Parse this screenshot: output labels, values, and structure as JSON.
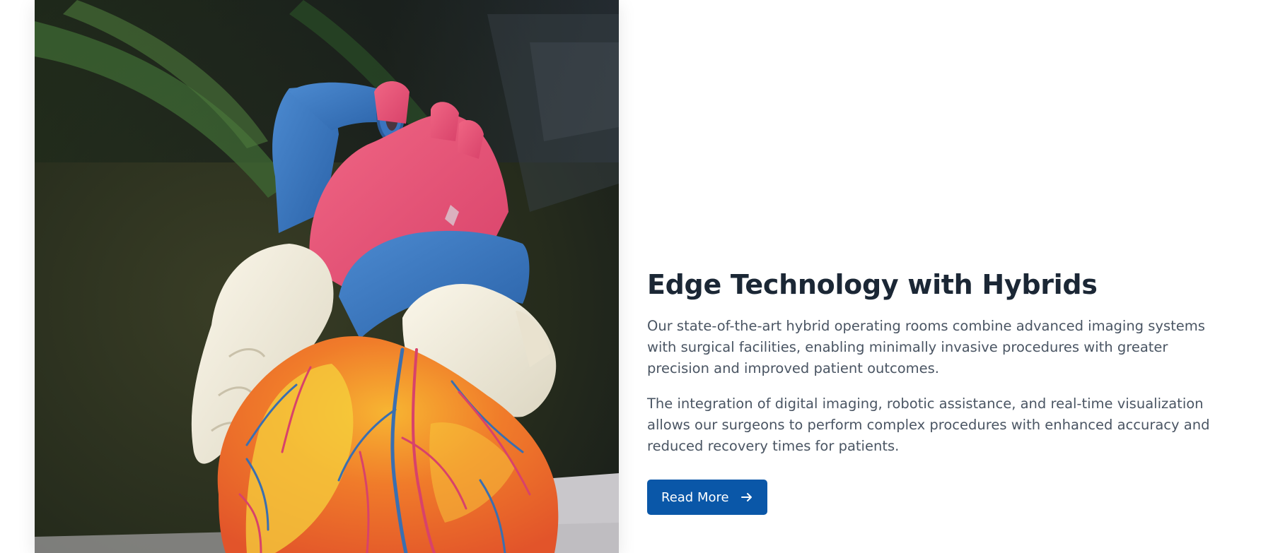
{
  "feature": {
    "image_alt": "Anatomical heart model",
    "heading": "Edge Technology with Hybrids",
    "paragraphs": [
      "Our state-of-the-art hybrid operating rooms combine advanced imaging systems with surgical facilities, enabling minimally invasive procedures with greater precision and improved patient outcomes.",
      "The integration of digital imaging, robotic assistance, and real-time visualization allows our surgeons to perform complex procedures with enhanced accuracy and reduced recovery times for patients."
    ],
    "cta_label": "Read More",
    "cta_icon": "arrow-right-icon"
  },
  "colors": {
    "heading": "#1b2735",
    "body_text": "#4a5563",
    "button_bg": "#0a57a8",
    "button_text": "#ffffff"
  }
}
